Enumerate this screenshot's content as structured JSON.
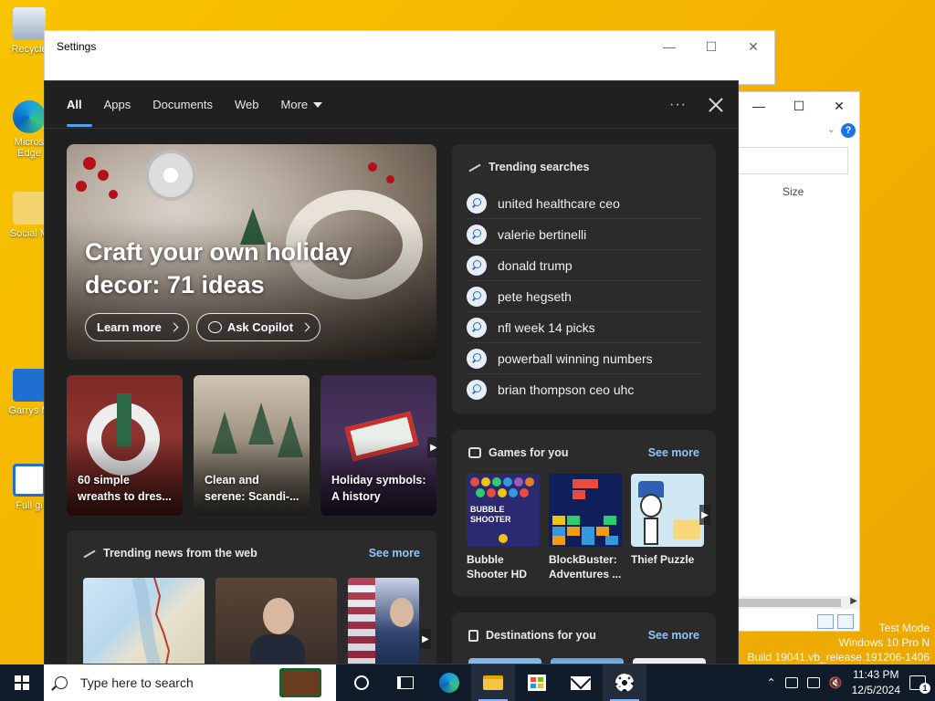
{
  "desktop": {
    "icons": [
      {
        "label": "Recycle"
      },
      {
        "label": "Micros Edge"
      },
      {
        "label": "Social M"
      },
      {
        "label": "Garrys M"
      },
      {
        "label": "Full gi"
      }
    ],
    "watermark": [
      "Test Mode",
      "Windows 10 Pro N",
      "Build 19041.vb_release.191206-1406"
    ]
  },
  "settings_window": {
    "title": "Settings"
  },
  "explorer_window": {
    "column_size": "Size",
    "help": "?"
  },
  "search": {
    "tabs": [
      "All",
      "Apps",
      "Documents",
      "Web",
      "More"
    ],
    "active_tab": "All",
    "hero": {
      "title": "Craft your own holiday decor: 71 ideas",
      "learn_more": "Learn more",
      "ask_copilot": "Ask Copilot"
    },
    "cards": [
      {
        "caption": "60 simple wreaths to dres..."
      },
      {
        "caption": "Clean and serene: Scandi-..."
      },
      {
        "caption": "Holiday symbols: A history"
      }
    ],
    "trending_searches": {
      "title": "Trending searches",
      "items": [
        "united healthcare ceo",
        "valerie bertinelli",
        "donald trump",
        "pete hegseth",
        "nfl week 14 picks",
        "powerball winning numbers",
        "brian thompson ceo uhc"
      ]
    },
    "games": {
      "title": "Games for you",
      "see_more": "See more",
      "items": [
        {
          "name": "Bubble Shooter HD",
          "art_text": "BUBBLE SHOOTER"
        },
        {
          "name": "BlockBuster: Adventures ..."
        },
        {
          "name": "Thief Puzzle"
        }
      ]
    },
    "news": {
      "title": "Trending news from the web",
      "see_more": "See more"
    },
    "destinations": {
      "title": "Destinations for you",
      "see_more": "See more"
    }
  },
  "taskbar": {
    "search_placeholder": "Type here to search",
    "time": "11:43 PM",
    "date": "12/5/2024",
    "notification_count": "1"
  },
  "colors": {
    "accent": "#4fa3e8",
    "link": "#8ec6ff",
    "desktop": "#f5b800",
    "taskbar": "#101b2a"
  }
}
